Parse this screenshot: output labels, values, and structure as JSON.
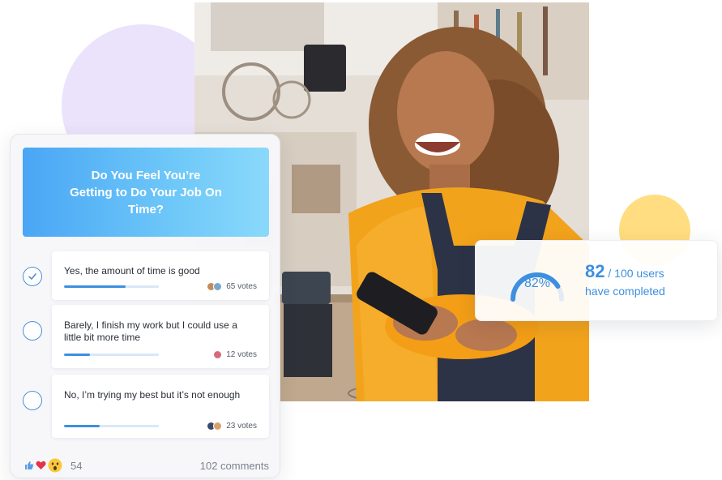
{
  "poll": {
    "question": "Do You Feel You’re Getting to Do Your Job On Time?",
    "options": [
      {
        "text": "Yes, the amount of time is good",
        "votes": "65 votes",
        "selected": true,
        "progress_percent": 65
      },
      {
        "text": "Barely, I finish my work but I could use a little bit more time",
        "votes": "12 votes",
        "selected": false,
        "progress_percent": 27
      },
      {
        "text": "No, I’m trying my best but it’s not enough",
        "votes": "23 votes",
        "selected": false,
        "progress_percent": 38
      }
    ],
    "reactions": {
      "icons": [
        "thumbs-up-icon",
        "heart-icon",
        "wow-emoji-icon"
      ],
      "count": "54"
    },
    "comments": "102 comments"
  },
  "completion": {
    "gauge_label": "82%",
    "gauge_percent": 82,
    "count": "82",
    "total": "/ 100 users",
    "subtitle": "have completed"
  },
  "colors": {
    "accent": "#3d8fe0",
    "purple_circle": "#ebe3fb",
    "yellow_circle": "#ffdd80",
    "header_gradient_start": "#4aa6f5",
    "header_gradient_end": "#8ad9fb"
  }
}
